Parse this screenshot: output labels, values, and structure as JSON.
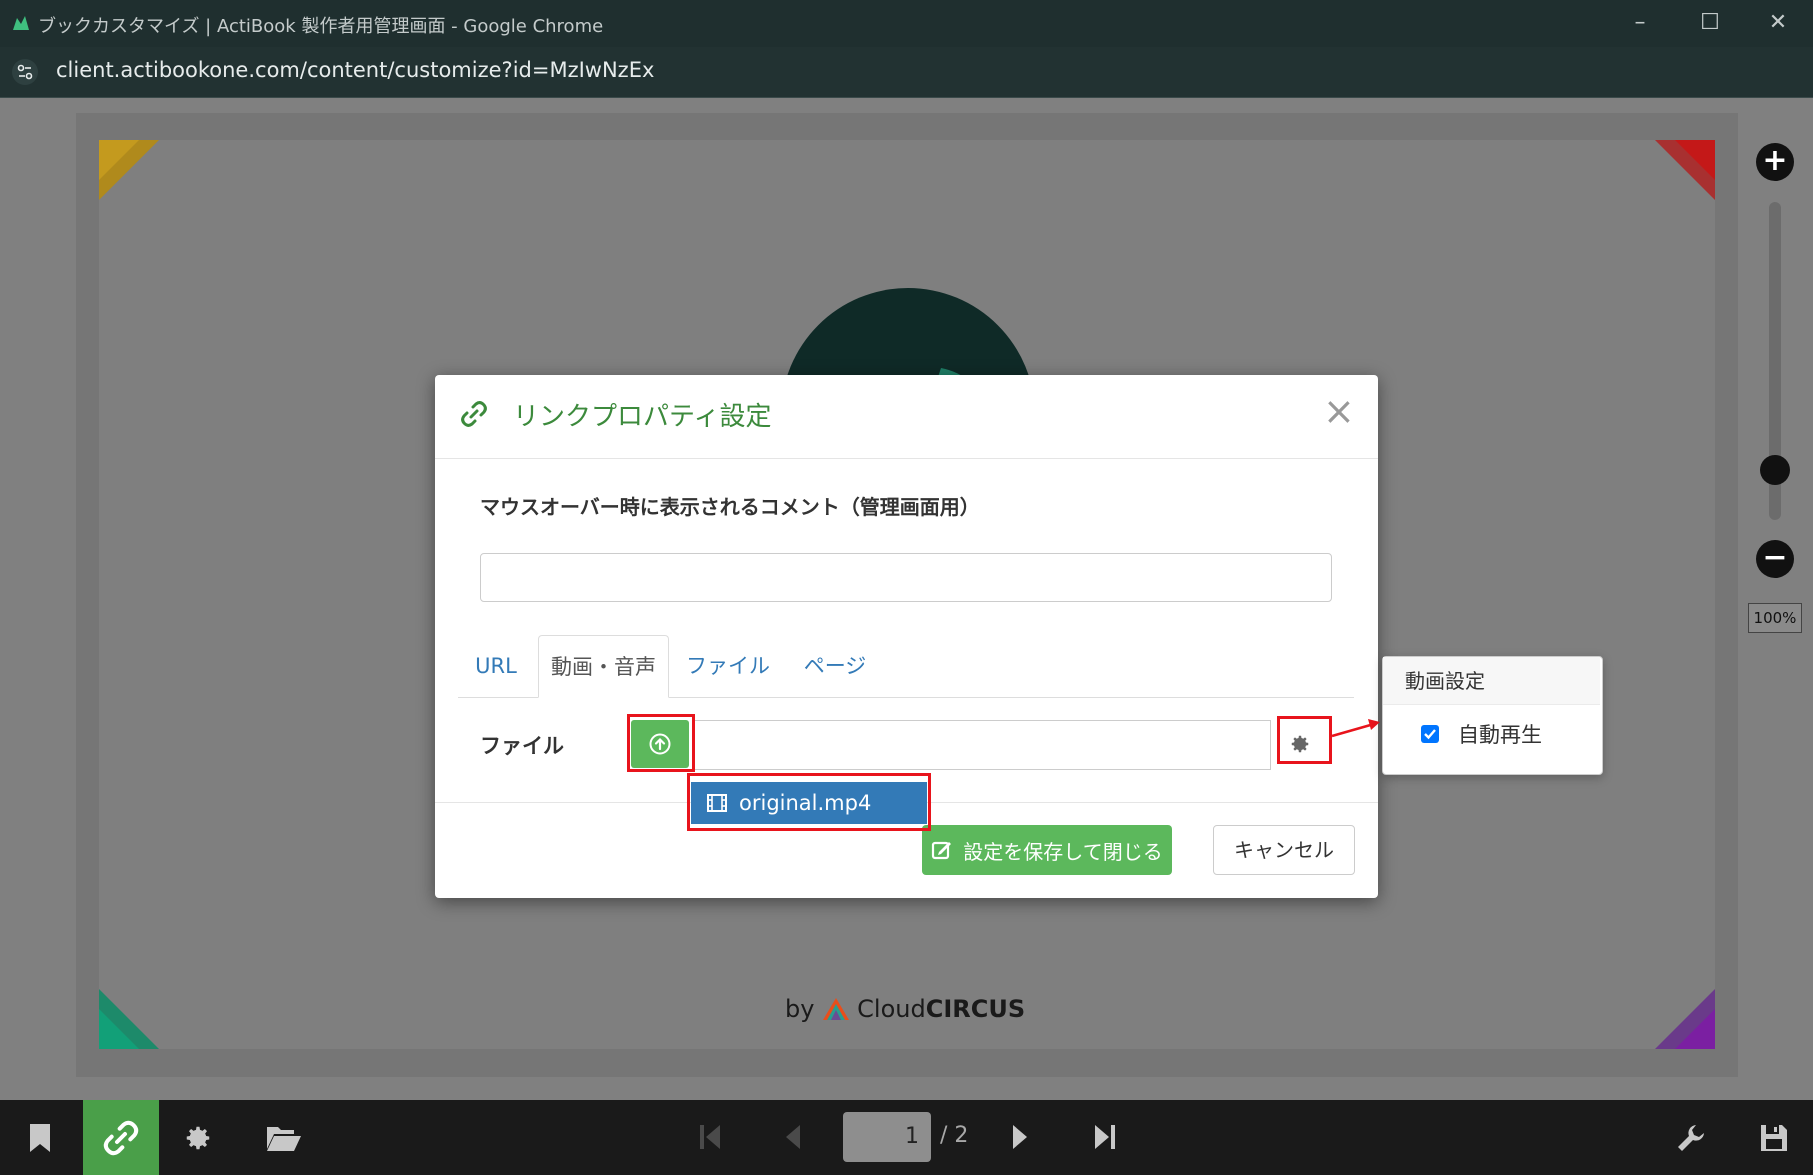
{
  "window": {
    "title": "ブックカスタマイズ | ActiBook 製作者用管理画面 - Google Chrome",
    "minimize_icon": "minimize-icon",
    "maximize_icon": "maximize-icon",
    "close_icon": "close-icon"
  },
  "address_bar": {
    "url": "client.actibookone.com/content/customize?id=MzIwNzEx"
  },
  "canvas": {
    "byline": "by",
    "brand_plain": "Cloud",
    "brand_bold": "CIRCUS",
    "zoom_level": "100%"
  },
  "modal": {
    "title": "リンクプロパティ設定",
    "close_label": "×",
    "comment_label": "マウスオーバー時に表示されるコメント（管理画面用）",
    "comment_value": "",
    "tabs": [
      {
        "label": "URL",
        "active": false
      },
      {
        "label": "動画・音声",
        "active": true
      },
      {
        "label": "ファイル",
        "active": false
      },
      {
        "label": "ページ",
        "active": false
      }
    ],
    "file_label": "ファイル",
    "file_value": "",
    "dropdown_item": "original.mp4",
    "save_label": "設定を保存して閉じる",
    "cancel_label": "キャンセル"
  },
  "popover": {
    "title": "動画設定",
    "autoplay_label": "自動再生",
    "autoplay_checked": true
  },
  "bottom_toolbar": {
    "tools": [
      "bookmark-icon",
      "link-icon",
      "gear-icon",
      "folder-open-icon"
    ],
    "active_tool": "link-icon",
    "current_page": "1",
    "page_total": "/ 2",
    "right_tools": [
      "wrench-icon",
      "save-icon"
    ]
  },
  "colors": {
    "accent_green": "#5cb85c",
    "selection_blue": "#337ab7",
    "highlight_red": "#e8141c"
  }
}
